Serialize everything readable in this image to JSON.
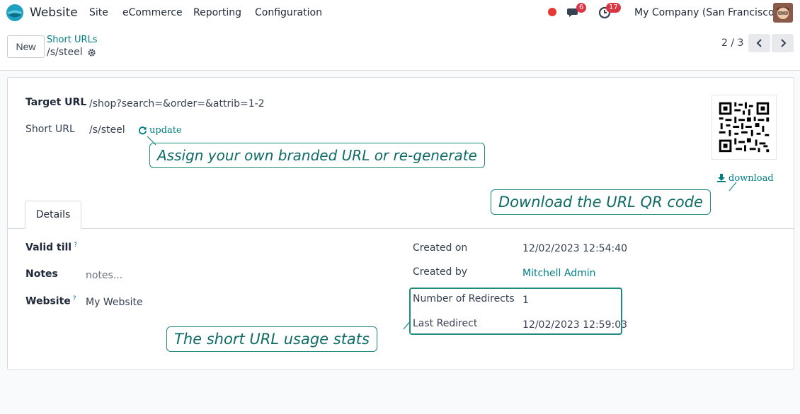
{
  "navbar": {
    "app_name": "Website",
    "menu": [
      "Site",
      "eCommerce",
      "Reporting",
      "Configuration"
    ],
    "messages_count": "6",
    "activities_count": "17",
    "company": "My Company (San Francisco)"
  },
  "control": {
    "new_label": "New",
    "breadcrumb_parent": "Short URLs",
    "breadcrumb_current": "/s/steel",
    "pager": "2 / 3"
  },
  "form": {
    "target_url_label": "Target URL",
    "target_url_value": "/shop?search=&order=&attrib=1-2",
    "short_url_label": "Short URL",
    "short_url_value": "/s/steel",
    "update_label": "update",
    "download_label": "download",
    "tab_details": "Details",
    "valid_till_label": "Valid till",
    "help_mark": "?",
    "notes_label": "Notes",
    "notes_placeholder": "notes...",
    "website_label": "Website",
    "website_value": "My Website",
    "created_on_label": "Created on",
    "created_on_value": "12/02/2023 12:54:40",
    "created_by_label": "Created by",
    "created_by_value": "Mitchell Admin",
    "redirects_label": "Number of Redirects",
    "redirects_value": "1",
    "last_redirect_label": "Last Redirect",
    "last_redirect_value": "12/02/2023 12:59:03"
  },
  "callouts": {
    "branded_url": "Assign your own branded URL or re-generate",
    "qr_download": "Download the URL QR code",
    "usage_stats": "The short URL usage stats"
  },
  "colors": {
    "accent": "#017e84",
    "callout_border": "#1e8a80",
    "badge": "#dc3545"
  }
}
